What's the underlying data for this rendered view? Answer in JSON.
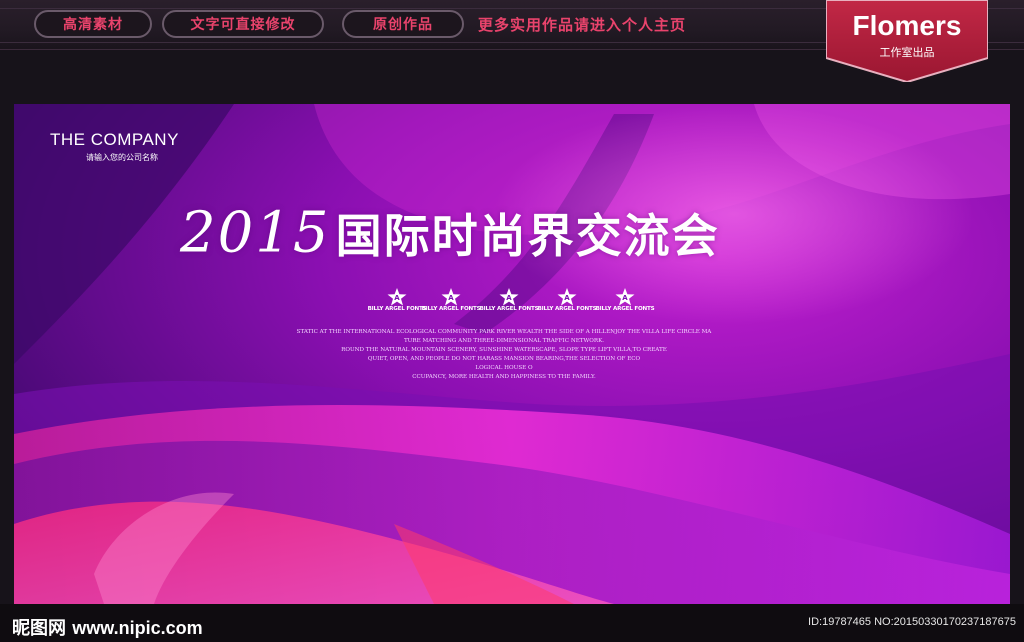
{
  "top_bar": {
    "tags": [
      "高清素材",
      "文字可直接修改",
      "原创作品"
    ],
    "promo": "更多实用作品请进入个人主页"
  },
  "brand": {
    "name": "Flomers",
    "sub": "工作室出品",
    "color": "#b3203e"
  },
  "banner": {
    "company": "THE COMPANY",
    "company_sub": "请输入您的公司名称",
    "year": "2015",
    "title": "国际时尚界交流会",
    "font_badges": [
      "BILLY ARGEL FONTS",
      "BILLY ARGEL FONTS",
      "BILLY ARGEL FONTS",
      "BILLY ARGEL FONTS",
      "BILLY ARGEL FONTS"
    ],
    "badge_letter": "A",
    "description": [
      "STATIC AT THE INTERNATIONAL ECOLOGICAL COMMUNITY PARK RIVER WEALTH THE SIDE OF A HILLENJOY THE VILLA LIFE CIRCLE MA",
      "TURE MATCHING AND THREE-DIMENSIONAL TRAFFIC NETWORK.",
      "ROUND THE NATURAL MOUNTAIN SCENERY, SUNSHINE WATERSCAPE, SLOPE TYPE LIFT VILLA,TO CREATE",
      "QUIET, OPEN, AND PEOPLE DO NOT HARASS MANSION BEARING,THE SELECTION OF ECO",
      "LOGICAL HOUSE O",
      "CCUPANCY, MORE HEALTH AND HAPPINESS TO THE FAMILY."
    ]
  },
  "footer": {
    "watermark_cn": "昵图网",
    "watermark_url": "www.nipic.com",
    "image_id": "ID:19787465 NO:20150330170237187675"
  }
}
